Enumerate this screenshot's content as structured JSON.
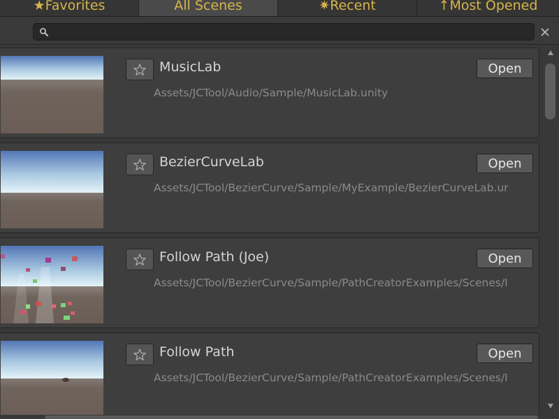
{
  "tabs": [
    {
      "label": "★Favorites",
      "active": false
    },
    {
      "label": "All Scenes",
      "active": true
    },
    {
      "label": "✷Recent",
      "active": false
    },
    {
      "label": "↑Most Opened",
      "active": false
    }
  ],
  "search": {
    "value": "",
    "icon": "search-icon",
    "clear_icon": "close-icon"
  },
  "scenes": [
    {
      "name": "MusicLab",
      "path": "Assets/JCTool/Audio/Sample/MusicLab.unity",
      "open_label": "Open",
      "favorite": false,
      "thumbnail": "sky-ground"
    },
    {
      "name": "BezierCurveLab",
      "path": "Assets/JCTool/BezierCurve/Sample/MyExample/BezierCurveLab.ur",
      "open_label": "Open",
      "favorite": false,
      "thumbnail": "sky-ground"
    },
    {
      "name": "Follow Path (Joe)",
      "path": "Assets/JCTool/BezierCurve/Sample/PathCreatorExamples/Scenes/I",
      "open_label": "Open",
      "favorite": false,
      "thumbnail": "sky-ground-with-objects"
    },
    {
      "name": "Follow Path",
      "path": "Assets/JCTool/BezierCurve/Sample/PathCreatorExamples/Scenes/I",
      "open_label": "Open",
      "favorite": false,
      "thumbnail": "sky-ground-with-object"
    }
  ],
  "colors": {
    "tab_text": "#d7b54a",
    "background": "#383838",
    "card": "#3e3e3e",
    "button": "#585858",
    "sky_top": "#5577b6",
    "horizon": "#dff1f6",
    "ground": "#6e6259"
  }
}
